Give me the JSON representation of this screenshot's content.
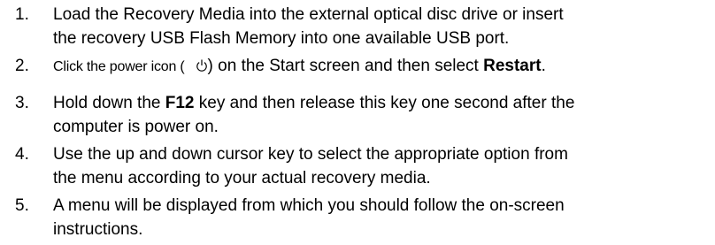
{
  "steps": [
    {
      "number": "1.",
      "line1": "Load the Recovery Media into the external optical disc drive or insert",
      "line2": "the recovery USB Flash Memory into one available USB port."
    },
    {
      "number": "2.",
      "part1": "Click the power icon (",
      "part2": ") on the Start screen and then select ",
      "bold": "Restart",
      "part3": ".",
      "icon": "power-icon"
    },
    {
      "number": "3.",
      "part1": "Hold down the ",
      "bold": "F12",
      "part2": " key and then release this key one second after the",
      "line2": "computer is power on."
    },
    {
      "number": "4.",
      "line1": "Use the up and down cursor key to select the appropriate option from",
      "line2": "the menu according to your actual recovery media."
    },
    {
      "number": "5.",
      "line1": "A menu will be displayed from which you should follow the on-screen",
      "line2": "instructions."
    }
  ]
}
